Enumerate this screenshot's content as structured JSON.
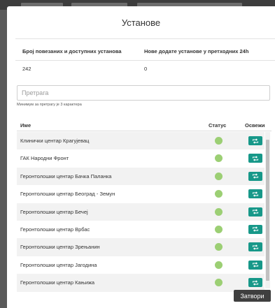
{
  "modal": {
    "title": "Установе",
    "close_label": "Затвори"
  },
  "stats": {
    "linked_label": "Број повезаних и доступних установа",
    "new_label": "Нове додате установе у претходних 24h",
    "linked_value": "242",
    "new_value": "0"
  },
  "search": {
    "placeholder": "Претрага",
    "value": "",
    "hint": "Минимум за претрагу је 3 карактера"
  },
  "table": {
    "columns": {
      "name": "Име",
      "status": "Статус",
      "refresh": "Освежи"
    },
    "rows": [
      {
        "name": "Клинички центар Крагујевац",
        "status": "green"
      },
      {
        "name": "ГАК Народни Фронт",
        "status": "green"
      },
      {
        "name": "Геронтолошки центар Бачка Паланка",
        "status": "green"
      },
      {
        "name": "Геронтолошки центар Београд - Земун",
        "status": "green"
      },
      {
        "name": "Геронтолошки центар Бечеј",
        "status": "green"
      },
      {
        "name": "Геронтолошки центар Врбас",
        "status": "green"
      },
      {
        "name": "Геронтолошки центар Зрењанин",
        "status": "green"
      },
      {
        "name": "Геронтолошки центар Јагодина",
        "status": "green"
      },
      {
        "name": "Геронтолошки центар Кањижа",
        "status": "green"
      }
    ]
  },
  "icons": {
    "status": "status-dot-icon",
    "refresh": "refresh-icon"
  },
  "colors": {
    "status_ok": "#9ccf74",
    "refresh_button": "#179889",
    "close_button": "#3f3f3f"
  }
}
